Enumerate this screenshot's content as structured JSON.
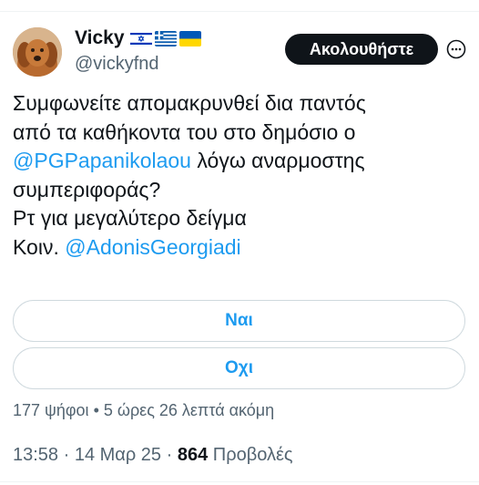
{
  "author": {
    "display_name": "Vicky",
    "handle": "@vickyfnd",
    "flags": [
      "israel-flag",
      "greece-flag",
      "ukraine-flag"
    ]
  },
  "follow_button": {
    "label": "Ακολουθήστε"
  },
  "more_icon": "more-options-icon",
  "tweet": {
    "line1": "Συμφωνείτε απομακρυνθεί δια παντός",
    "line2": "από τα καθήκοντα του στο δημόσιο ο",
    "mention1": "@PGPapanikolaou",
    "line3_rest": " λόγω αναρμοστης",
    "line4": "συμπεριφοράς?",
    "line5": "Ρτ για μεγαλύτερο δείγμα",
    "line6_prefix": "Κοιν. ",
    "mention2": "@AdonisGeorgiadi"
  },
  "poll": {
    "options": [
      {
        "label": "Ναι"
      },
      {
        "label": "Οχι"
      }
    ],
    "votes": "177 ψήφοι",
    "separator": " • ",
    "time_left": "5 ώρες 26 λεπτά ακόμη"
  },
  "meta": {
    "time": "13:58",
    "dot1": " · ",
    "date": "14 Μαρ 25",
    "dot2": " · ",
    "views_count": "864",
    "views_label": " Προβολές"
  },
  "colors": {
    "accent": "#1d9bf0",
    "text": "#0f1419",
    "muted": "#536471",
    "border": "#cfd9de"
  }
}
